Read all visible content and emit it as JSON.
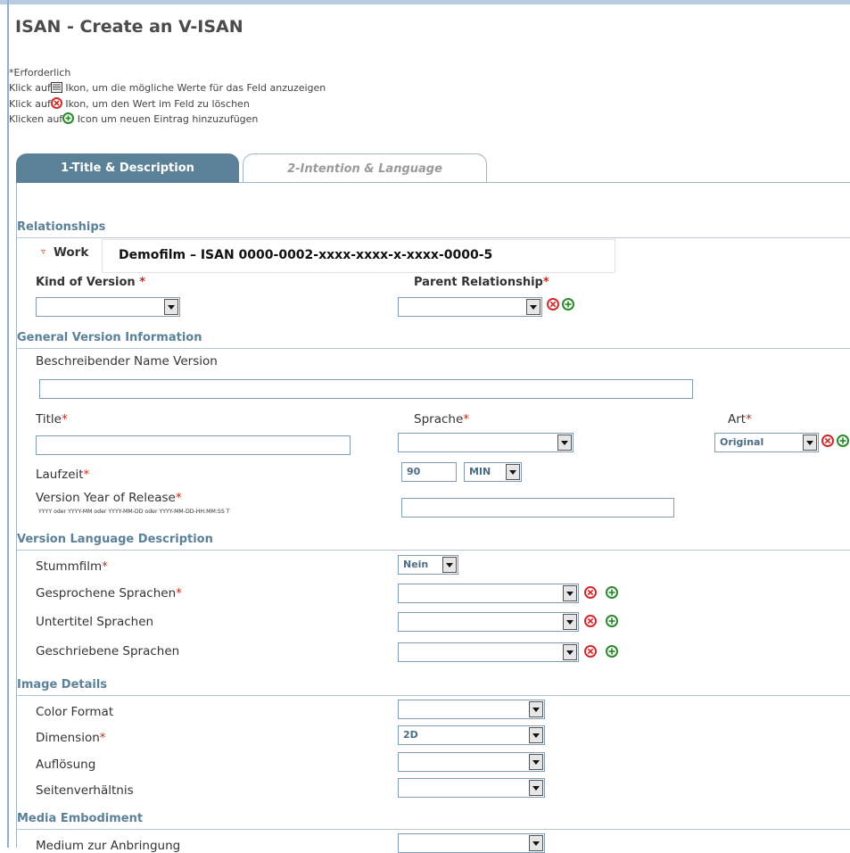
{
  "page": {
    "title": "ISAN - Create an V-ISAN"
  },
  "help": {
    "required": "*Erforderlich",
    "line1": "Ikon, um die mögliche Werte für das Feld anzuzeigen",
    "line2": "Ikon, um den Wert im Feld zu löschen",
    "line3": "Icon um neuen Eintrag hinzuzufügen",
    "click_on": "Klick auf",
    "click_on_alt": "Klicken auf"
  },
  "tabs": [
    {
      "label": "1-Title & Description"
    },
    {
      "label": "2-Intention & Language"
    }
  ],
  "relationships": {
    "section": "Relationships",
    "work_label": "Work",
    "work_value": "Demofilm – ISAN 0000-0002-xxxx-xxxx-x-xxxx-0000-5",
    "kind_of_version": "Kind of Version",
    "parent_relationship": "Parent Relationship"
  },
  "general": {
    "section": "General Version Information",
    "desc_name": "Beschreibender Name Version",
    "title": "Title",
    "sprache": "Sprache",
    "art": "Art",
    "art_value": "Original",
    "laufzeit": "Laufzeit",
    "laufzeit_value": "90",
    "laufzeit_unit": "MIN",
    "year": "Version Year of Release",
    "year_hint": "YYYY oder YYYY-MM oder YYYY-MM-DD oder YYYY-MM-DD-HH:MM:SS T"
  },
  "language": {
    "section": "Version Language Description",
    "stummfilm": "Stummfilm",
    "stummfilm_value": "Nein",
    "gesprochene": "Gesprochene Sprachen",
    "untertitel": "Untertitel Sprachen",
    "geschriebene": "Geschriebene Sprachen"
  },
  "image": {
    "section": "Image Details",
    "color": "Color Format",
    "dimension": "Dimension",
    "dimension_value": "2D",
    "aufloesung": "Auflösung",
    "seiten": "Seitenverhältnis"
  },
  "media": {
    "section": "Media Embodiment",
    "medium": "Medium zur Anbringung"
  },
  "required_mark": "*"
}
